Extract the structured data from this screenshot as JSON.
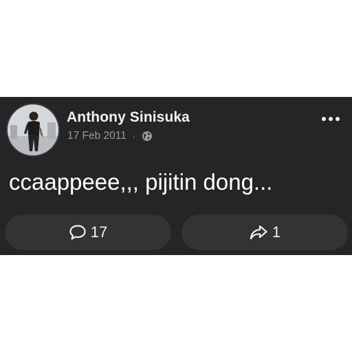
{
  "post": {
    "author": "Anthony Sinisuka",
    "date": "17 Feb 2011",
    "separator": "·",
    "privacy_icon": "globe-icon",
    "text": "ccaappeee,,, pijitin dong...",
    "comments_count": "17",
    "shares_count": "1"
  },
  "icons": {
    "comment": "comment-icon",
    "share": "share-icon",
    "more": "more-options-icon"
  },
  "colors": {
    "card_background": "#252527",
    "button_background": "#333335",
    "primary_text": "#f2f2f2",
    "secondary_text": "#9b9b9e"
  }
}
